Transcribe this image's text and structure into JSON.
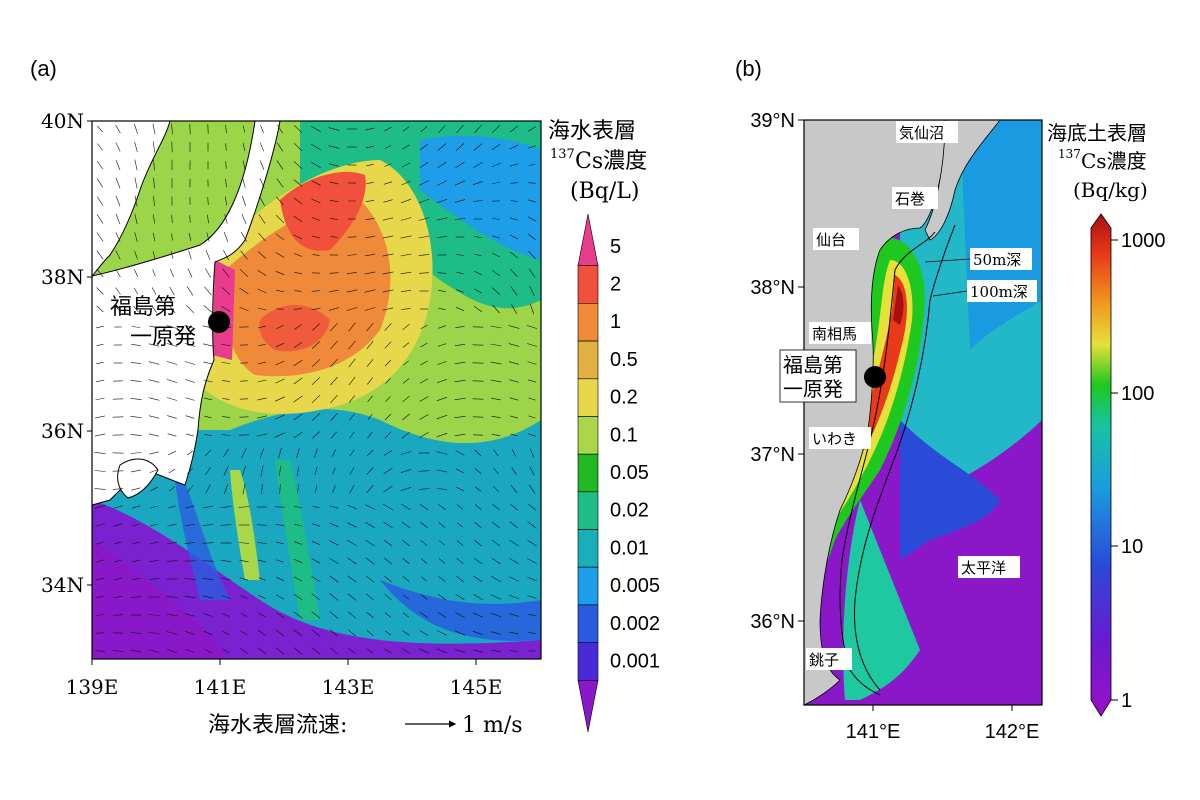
{
  "panel_a": {
    "label": "(a)",
    "lat_ticks": [
      "40N",
      "38N",
      "36N",
      "34N"
    ],
    "lon_ticks": [
      "139E",
      "141E",
      "143E",
      "145E"
    ],
    "site_label_line1": "福島第",
    "site_label_line2": "一原発",
    "velocity_label": "海水表層流速:",
    "velocity_ref": "1 m/s",
    "colorbar_title_line1": "海水表層",
    "colorbar_title_sup": "137",
    "colorbar_title_line2": "Cs濃度",
    "colorbar_title_line3": "(Bq/L)",
    "colorbar_levels": [
      "5",
      "2",
      "1",
      "0.5",
      "0.2",
      "0.1",
      "0.05",
      "0.02",
      "0.01",
      "0.005",
      "0.002",
      "0.001"
    ],
    "colorbar_colors": [
      "#e83c8c",
      "#f0503c",
      "#ee8a3a",
      "#e0b040",
      "#e6d84a",
      "#a8d84a",
      "#22b822",
      "#1ebc86",
      "#1aaeb8",
      "#1e9ee8",
      "#2a5ce0",
      "#4a2ad8",
      "#8a18c8"
    ]
  },
  "panel_b": {
    "label": "(b)",
    "lat_ticks": [
      "39°N",
      "38°N",
      "37°N",
      "36°N"
    ],
    "lon_ticks": [
      "141°E",
      "142°E"
    ],
    "places": {
      "kesennuma": "気仙沼",
      "ishinomaki": "石巻",
      "sendai": "仙台",
      "minamisoma": "南相馬",
      "iwaki": "いわき",
      "choshi": "銚子",
      "pacific": "太平洋"
    },
    "contour_50": "50m深",
    "contour_100": "100m深",
    "site_label_line1": "福島第",
    "site_label_line2": "一原発",
    "colorbar_title_line1": "海底土表層",
    "colorbar_title_sup": "137",
    "colorbar_title_line2": "Cs濃度",
    "colorbar_title_line3": "(Bq/kg)",
    "colorbar_ticks": [
      "1000",
      "100",
      "10",
      "1"
    ],
    "colorbar_colors": [
      "#a81010",
      "#e83a18",
      "#f09a20",
      "#e6e038",
      "#1ec81e",
      "#18c4a0",
      "#1a9ae0",
      "#2a4ad8",
      "#6a1ad0",
      "#9a10c8"
    ]
  }
}
